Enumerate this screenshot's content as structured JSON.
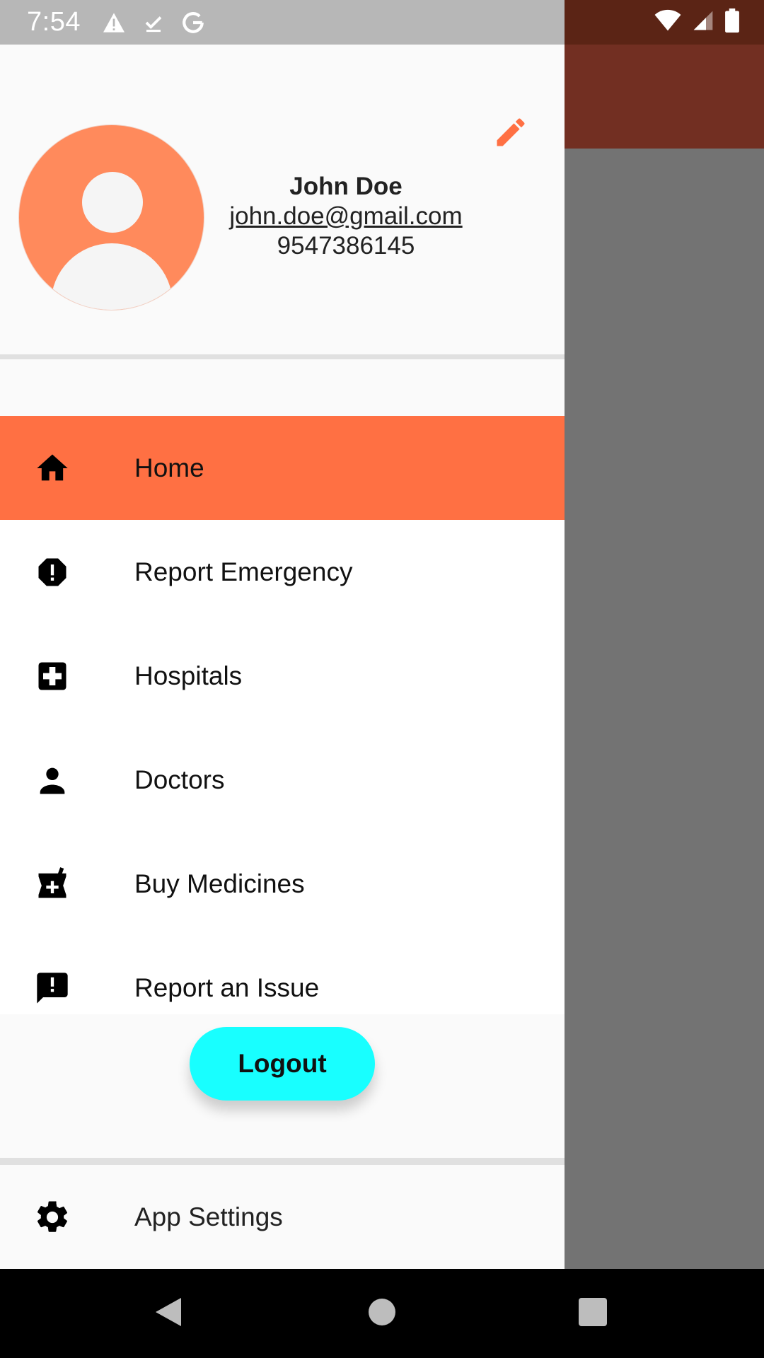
{
  "status_bar": {
    "time": "7:54",
    "left_icons": [
      "alert-triangle-icon",
      "download-done-icon",
      "google-g-icon"
    ],
    "right_icons": [
      "wifi-icon",
      "signal-icon",
      "battery-icon"
    ]
  },
  "user": {
    "name": "John Doe",
    "email": "john.doe@gmail.com",
    "phone": "9547386145"
  },
  "menu": {
    "items": [
      {
        "label": "Home",
        "icon": "home-icon",
        "active": true
      },
      {
        "label": "Report Emergency",
        "icon": "report-octagon-icon",
        "active": false
      },
      {
        "label": "Hospitals",
        "icon": "hospital-cross-icon",
        "active": false
      },
      {
        "label": "Doctors",
        "icon": "person-icon",
        "active": false
      },
      {
        "label": "Buy Medicines",
        "icon": "medication-icon",
        "active": false
      },
      {
        "label": "Report an Issue",
        "icon": "feedback-icon",
        "active": false
      }
    ]
  },
  "logout_label": "Logout",
  "settings": {
    "label": "App Settings",
    "icon": "gear-icon"
  },
  "colors": {
    "accent": "#ff7043",
    "avatar_bg": "#ff8a5c",
    "logout_bg": "#18ffff",
    "app_bar": "#722f22",
    "scrim": "#737373"
  },
  "nav_bar": [
    "back-icon",
    "home-circle-icon",
    "recents-square-icon"
  ]
}
